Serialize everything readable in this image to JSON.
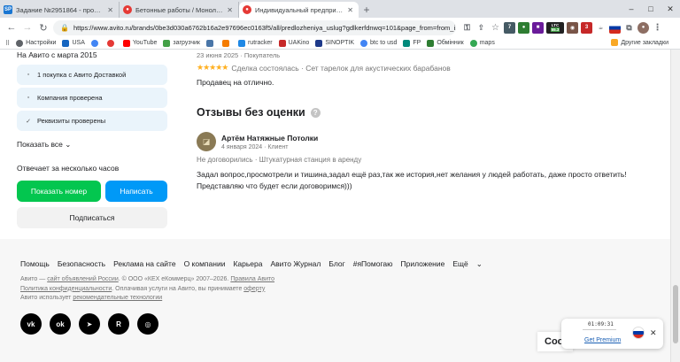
{
  "tabs": [
    {
      "title": "Задание №2951864 - просмотр з",
      "favicon": "SP",
      "color": "#1976d2"
    },
    {
      "title": "Бетонные работы / Монолит (79",
      "favicon": "●",
      "color": "#e53935"
    },
    {
      "title": "Индивидуальный предпринимат",
      "favicon": "●",
      "color": "#e53935",
      "active": true
    }
  ],
  "window_controls": {
    "minimize": "–",
    "maximize": "□",
    "close": "✕"
  },
  "address": {
    "url": "https://www.avito.ru/brands/0be3d030a6762b16a2e97696ec0163f5/all/predlozheniya_uslug?gdlkerfdnwq=101&page_from=from_i..."
  },
  "extensions": {
    "ext1_badge": "7",
    "ltc_label": "LTC",
    "ltc_value": "55.3",
    "p_badge": "3"
  },
  "bookmarks": [
    {
      "label": "Настройки",
      "color": "#5f6368"
    },
    {
      "label": "USA",
      "color": "#1565c0"
    },
    {
      "label": "G",
      "color": "#4285f4"
    },
    {
      "label": "Я",
      "color": "#e53935"
    },
    {
      "label": "YouTube",
      "color": "#ff0000"
    },
    {
      "label": "загрузчик",
      "color": "#43a047"
    },
    {
      "label": "ВК",
      "color": "#4a76a8"
    },
    {
      "label": "F",
      "color": "#f57c00"
    },
    {
      "label": "rutracker",
      "color": "#1e88e5"
    },
    {
      "label": "UAKino",
      "color": "#c62828"
    },
    {
      "label": "SINOPTIK",
      "color": "#1e3a8a"
    },
    {
      "label": "btc to usd",
      "color": "#4285f4"
    },
    {
      "label": "FP",
      "color": "#00897b"
    },
    {
      "label": "Обмінник",
      "color": "#2e7d32"
    },
    {
      "label": "maps",
      "color": "#34a853"
    }
  ],
  "other_bookmarks": "Другие закладки",
  "seller": {
    "since": "На Авито с марта 2015",
    "badges": [
      "1 покупка с Авито Доставкой",
      "Компания проверена",
      "Реквизиты проверены"
    ],
    "show_all": "Показать все",
    "responds": "Отвечает за несколько часов",
    "btn_phone": "Показать номер",
    "btn_write": "Написать",
    "btn_subscribe": "Подписаться"
  },
  "review_top": {
    "date": "23 июня 2025 · Покупатель",
    "stars": 5,
    "meta": "Сделка состоялась · Сет тарелок для акустических барабанов",
    "text": "Продавец на отлично."
  },
  "no_rating": {
    "title": "Отзывы без оценки",
    "reviewer": "Артём Натяжные Потолки",
    "date": "4 января 2024 · Клиент",
    "status": "Не договорились · Штукатурная станция в аренду",
    "text1": "Задал вопрос,просмотрели и тишина,задал ещё раз,так же история,нет желания у людей работать, даже просто ответить!",
    "text2": "Представляю что будет если договоримся)))"
  },
  "footer": {
    "links": [
      "Помощь",
      "Безопасность",
      "Реклама на сайте",
      "О компании",
      "Карьера",
      "Авито Журнал",
      "Блог",
      "#яПомогаю",
      "Приложение",
      "Ещё"
    ],
    "line1_a": "Авито — ",
    "line1_link1": "сайт объявлений России",
    "line1_b": ". © ООО «КЕХ еКоммерц» 2007–2026. ",
    "line1_link2": "Правила Авито",
    "line2_link": "Политика конфиденциальности",
    "line2_b": ". Оплачивая услуги на Авито, вы принимаете ",
    "line2_link2": "оферту",
    "line3_a": "Авито использует ",
    "line3_link": "рекомендательные технологии",
    "socials": [
      "vk",
      "ok",
      "tg",
      "r",
      "dzen"
    ]
  },
  "cookie_text": "Coo",
  "vpn_popup": {
    "timer": "01:09:31",
    "link": "Get Premium"
  }
}
